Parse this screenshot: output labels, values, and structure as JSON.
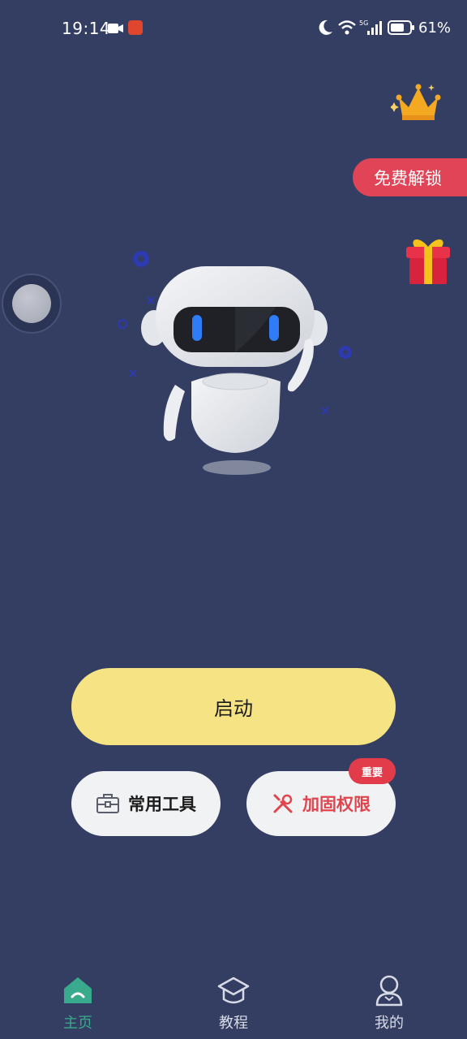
{
  "status_bar": {
    "time": "19:14",
    "battery": "61%",
    "icons": [
      "camera-icon",
      "app-notification-icon",
      "moon-icon",
      "wifi-icon",
      "signal-5g-icon",
      "battery-icon"
    ]
  },
  "promo": {
    "unlock_label": "免费解锁",
    "crown_icon": "crown-icon",
    "gift_icon": "gift-icon"
  },
  "actions": {
    "start_label": "启动",
    "tools_label": "常用工具",
    "permission_label": "加固权限",
    "permission_badge": "重要"
  },
  "nav": {
    "items": [
      {
        "label": "主页",
        "icon": "home-icon",
        "active": true
      },
      {
        "label": "教程",
        "icon": "graduation-cap-icon",
        "active": false
      },
      {
        "label": "我的",
        "icon": "user-icon",
        "active": false
      }
    ]
  },
  "colors": {
    "background": "#343e63",
    "start_button": "#f6e383",
    "accent_red": "#e04456",
    "active_nav": "#3aaa8c"
  }
}
